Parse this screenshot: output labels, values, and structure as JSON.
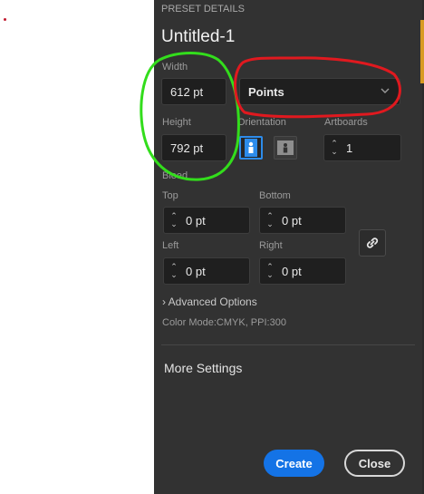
{
  "header": {
    "section_label": "PRESET DETAILS",
    "document_name": "Untitled-1"
  },
  "size": {
    "width_label": "Width",
    "width_value": "612 pt",
    "units_value": "Points",
    "height_label": "Height",
    "height_value": "792 pt"
  },
  "orientation": {
    "label": "Orientation",
    "selected": "portrait"
  },
  "artboards": {
    "label": "Artboards",
    "value": "1"
  },
  "bleed": {
    "label": "Bleed",
    "top_label": "Top",
    "top_value": "0 pt",
    "bottom_label": "Bottom",
    "bottom_value": "0 pt",
    "left_label": "Left",
    "left_value": "0 pt",
    "right_label": "Right",
    "right_value": "0 pt"
  },
  "advanced": {
    "label": "Advanced Options",
    "summary": "Color Mode:CMYK, PPI:300"
  },
  "more_settings": {
    "label": "More Settings"
  },
  "buttons": {
    "create_label": "Create",
    "close_label": "Close"
  },
  "colors": {
    "panel_bg": "#323232",
    "accent_blue": "#1473e6",
    "annotation_green": "#33dd1c",
    "annotation_red": "#e0191f"
  },
  "annotations": [
    {
      "shape": "green-ellipse",
      "target": "width-height-fields"
    },
    {
      "shape": "red-ellipse",
      "target": "units-select"
    }
  ]
}
